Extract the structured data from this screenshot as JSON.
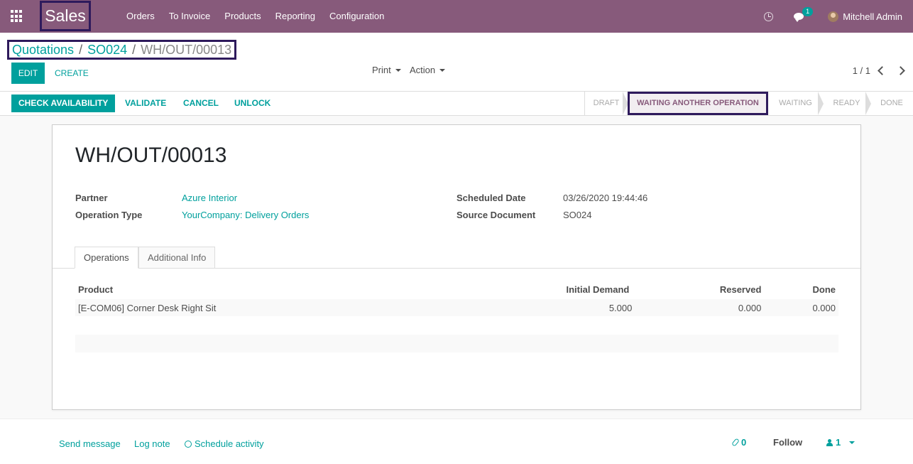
{
  "navbar": {
    "brand": "Sales",
    "menu": [
      "Orders",
      "To Invoice",
      "Products",
      "Reporting",
      "Configuration"
    ],
    "chat_count": "1",
    "user_name": "Mitchell Admin"
  },
  "breadcrumb": {
    "items": [
      "Quotations",
      "SO024"
    ],
    "current": "WH/OUT/00013"
  },
  "control": {
    "edit": "EDIT",
    "create": "CREATE",
    "print": "Print",
    "action": "Action",
    "pager": "1 / 1"
  },
  "statusbar": {
    "buttons": [
      "CHECK AVAILABILITY",
      "VALIDATE",
      "CANCEL",
      "UNLOCK"
    ],
    "states": [
      "DRAFT",
      "WAITING ANOTHER OPERATION",
      "WAITING",
      "READY",
      "DONE"
    ],
    "active_state": "WAITING ANOTHER OPERATION"
  },
  "record": {
    "title": "WH/OUT/00013",
    "partner_label": "Partner",
    "partner": "Azure Interior",
    "operation_type_label": "Operation Type",
    "operation_type": "YourCompany: Delivery Orders",
    "scheduled_date_label": "Scheduled Date",
    "scheduled_date": "03/26/2020 19:44:46",
    "source_document_label": "Source Document",
    "source_document": "SO024"
  },
  "tabs": [
    "Operations",
    "Additional Info"
  ],
  "operations": {
    "columns": [
      "Product",
      "Initial Demand",
      "Reserved",
      "Done"
    ],
    "rows": [
      [
        "[E-COM06] Corner Desk Right Sit",
        "5.000",
        "0.000",
        "0.000"
      ]
    ]
  },
  "chatter": {
    "send_message": "Send message",
    "log_note": "Log note",
    "schedule_activity": "Schedule activity",
    "attachments": "0",
    "follow": "Follow",
    "followers": "1"
  },
  "colors": {
    "brand": "#875a7b",
    "primary": "#00a09d",
    "highlight_border": "#2e1a5c"
  }
}
